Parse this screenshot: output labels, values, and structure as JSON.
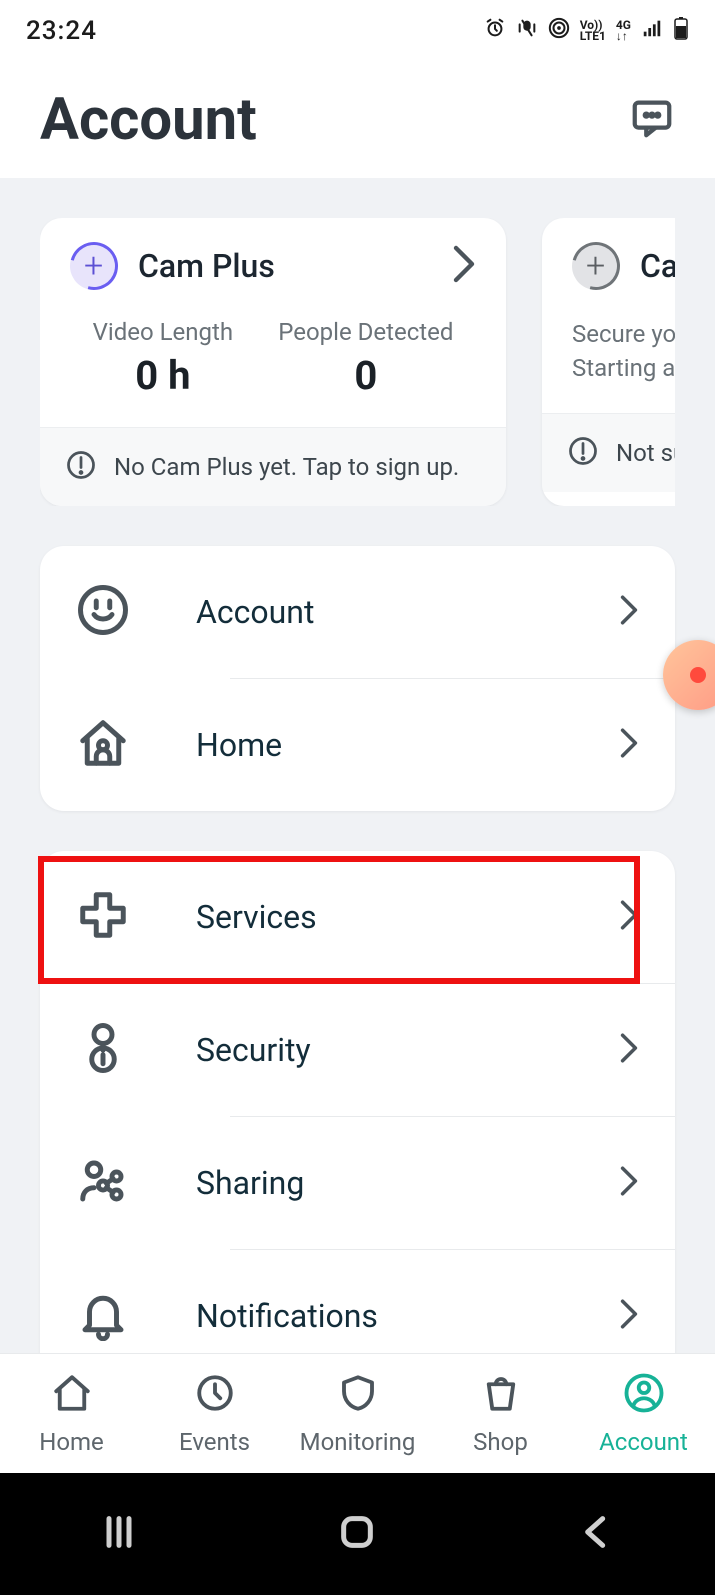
{
  "status": {
    "time": "23:24"
  },
  "header": {
    "title": "Account"
  },
  "promo": [
    {
      "title": "Cam Plus",
      "stat1_label": "Video Length",
      "stat1_value": "0 h",
      "stat2_label": "People Detected",
      "stat2_value": "0",
      "footer": "No Cam Plus yet. Tap to sign up."
    },
    {
      "title": "Cam",
      "desc_l1": "Secure your",
      "desc_l2": "Starting at $",
      "footer": "Not su"
    }
  ],
  "group1": {
    "items": [
      {
        "label": "Account"
      },
      {
        "label": "Home"
      }
    ]
  },
  "group2": {
    "items": [
      {
        "label": "Services"
      },
      {
        "label": "Security"
      },
      {
        "label": "Sharing"
      },
      {
        "label": "Notifications"
      }
    ]
  },
  "tabs": {
    "home": "Home",
    "events": "Events",
    "monitoring": "Monitoring",
    "shop": "Shop",
    "account": "Account"
  }
}
